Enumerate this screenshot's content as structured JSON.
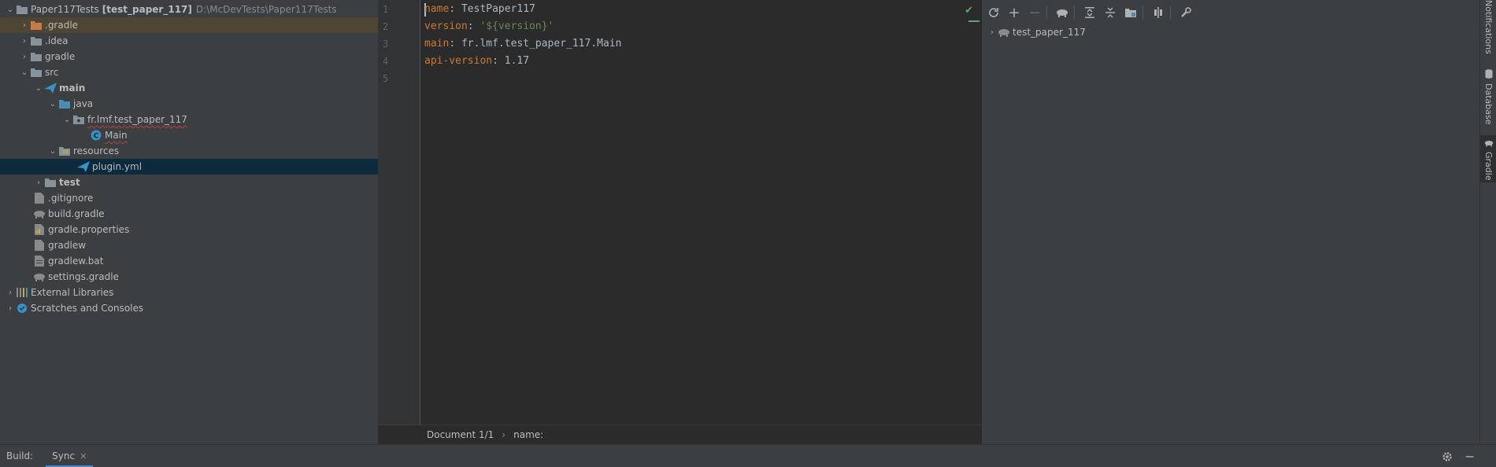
{
  "project": {
    "root_name": "Paper117Tests",
    "root_module": "[test_paper_117]",
    "root_path": "D:\\McDevTests\\Paper117Tests",
    "items": [
      {
        "label": ".gradle"
      },
      {
        "label": ".idea"
      },
      {
        "label": "gradle"
      },
      {
        "label": "src"
      },
      {
        "label": "main"
      },
      {
        "label": "java"
      },
      {
        "label": "fr.lmf.test_paper_117"
      },
      {
        "label": "Main"
      },
      {
        "label": "resources"
      },
      {
        "label": "plugin.yml"
      },
      {
        "label": "test"
      },
      {
        "label": ".gitignore"
      },
      {
        "label": "build.gradle"
      },
      {
        "label": "gradle.properties"
      },
      {
        "label": "gradlew"
      },
      {
        "label": "gradlew.bat"
      },
      {
        "label": "settings.gradle"
      },
      {
        "label": "External Libraries"
      },
      {
        "label": "Scratches and Consoles"
      }
    ]
  },
  "editor": {
    "line_numbers": [
      "1",
      "2",
      "3",
      "4",
      "5"
    ],
    "lines": [
      {
        "key": "name",
        "sep": ": ",
        "value": "TestPaper117"
      },
      {
        "key": "version",
        "sep": ": ",
        "value": "'${version}'"
      },
      {
        "key": "main",
        "sep": ": ",
        "value": "fr.lmf.test_paper_117.Main"
      },
      {
        "key": "api-version",
        "sep": ": ",
        "value": "1.17"
      }
    ]
  },
  "breadcrumb": {
    "doc": "Document 1/1",
    "path": "name:"
  },
  "gradle": {
    "project": "test_paper_117"
  },
  "stripe": {
    "notifications": "Notifications",
    "database": "Database",
    "gradle": "Gradle"
  },
  "bottom": {
    "build_label": "Build:",
    "sync_tab": "Sync"
  },
  "colors": {
    "accent": "#4a88c7",
    "selection": "#0d293e",
    "keyword": "#cc7832",
    "string": "#6a8759"
  }
}
